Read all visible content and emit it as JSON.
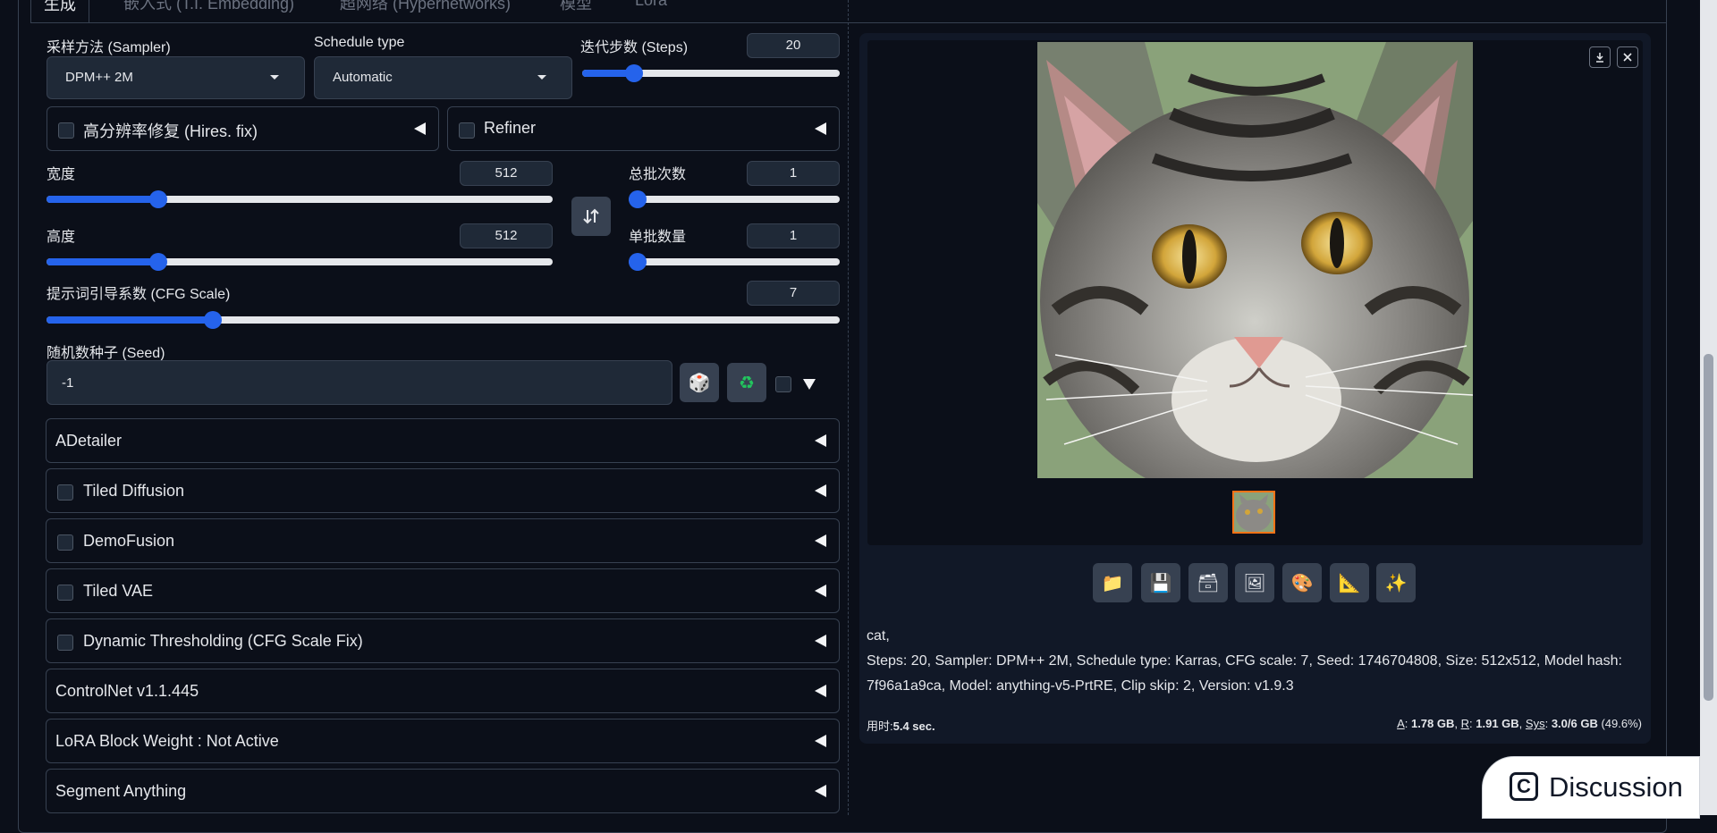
{
  "tabs": [
    "生成",
    "嵌入式 (T.I. Embedding)",
    "超网络 (Hypernetworks)",
    "模型",
    "Lora"
  ],
  "sampler": {
    "label": "采样方法 (Sampler)",
    "value": "DPM++ 2M"
  },
  "schedule": {
    "label": "Schedule type",
    "value": "Automatic"
  },
  "steps": {
    "label": "迭代步数 (Steps)",
    "value": "20",
    "level": 0.2
  },
  "hires": {
    "label": "高分辨率修复 (Hires. fix)"
  },
  "refiner": {
    "label": "Refiner"
  },
  "width": {
    "label": "宽度",
    "value": "512",
    "level": 0.22
  },
  "height": {
    "label": "高度",
    "value": "512",
    "level": 0.22
  },
  "batch_count": {
    "label": "总批次数",
    "value": "1",
    "level": 0.0
  },
  "batch_size": {
    "label": "单批数量",
    "value": "1",
    "level": 0.0
  },
  "cfg": {
    "label": "提示词引导系数 (CFG Scale)",
    "value": "7",
    "level": 0.21
  },
  "seed": {
    "label": "随机数种子 (Seed)",
    "value": "-1"
  },
  "accordions": [
    {
      "label": "ADetailer",
      "checkbox": false
    },
    {
      "label": "Tiled Diffusion",
      "checkbox": true
    },
    {
      "label": "DemoFusion",
      "checkbox": true
    },
    {
      "label": "Tiled VAE",
      "checkbox": true
    },
    {
      "label": "Dynamic Thresholding (CFG Scale Fix)",
      "checkbox": true
    },
    {
      "label": "ControlNet v1.1.445",
      "checkbox": false
    },
    {
      "label": "LoRA Block Weight : Not Active",
      "checkbox": false
    },
    {
      "label": "Segment Anything",
      "checkbox": false
    }
  ],
  "output": {
    "prompt": "cat,",
    "params_line1": "Steps: 20, Sampler: DPM++ 2M, Schedule type: Karras, CFG scale: 7, Seed: 1746704808, Size: 512x512, Model hash:",
    "params_line2": "7f96a1a9ca, Model: anything-v5-PrtRE, Clip skip: 2, Version: v1.9.3",
    "time_label": "用时:",
    "time_value": "5.4 sec.",
    "mem_a_label": "A",
    "mem_a_value": "1.78 GB",
    "mem_r_label": "R",
    "mem_r_value": "1.91 GB",
    "mem_sys_label": "Sys",
    "mem_sys_value": "3.0/6 GB",
    "mem_pct": "(49.6%)"
  },
  "tools": [
    "folder-icon",
    "save-icon",
    "zip-icon",
    "image-icon",
    "palette-icon",
    "ruler-icon",
    "sparkle-icon"
  ],
  "discussion": {
    "label": "Discussion"
  }
}
